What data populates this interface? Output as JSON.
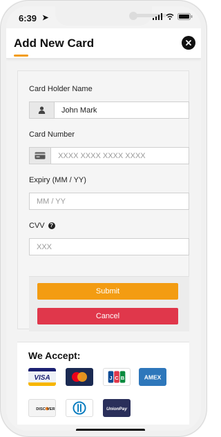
{
  "status_bar": {
    "time": "6:39",
    "icons": [
      "location-arrow-icon",
      "signal-icon",
      "wifi-icon",
      "battery-icon"
    ]
  },
  "header": {
    "title": "Add New Card",
    "accent_color": "#f39c12"
  },
  "form": {
    "holder_label": "Card Holder Name",
    "holder_value": "John Mark",
    "number_label": "Card Number",
    "number_placeholder": "XXXX XXXX XXXX XXXX",
    "expiry_label": "Expiry (MM / YY)",
    "expiry_placeholder": "MM / YY",
    "cvv_label": "CVV",
    "cvv_help": "?",
    "cvv_placeholder": "XXX",
    "submit_label": "Submit",
    "cancel_label": "Cancel",
    "submit_color": "#f39c12",
    "cancel_color": "#e0374b"
  },
  "accept": {
    "title": "We Accept:",
    "cards": [
      {
        "name": "VISA",
        "icon": "visa-logo"
      },
      {
        "name": "Mastercard",
        "icon": "mastercard-logo"
      },
      {
        "name": "JCB",
        "icon": "jcb-logo"
      },
      {
        "name": "AMEX",
        "icon": "amex-logo"
      },
      {
        "name": "DISCOVER",
        "icon": "discover-logo"
      },
      {
        "name": "Diners Club",
        "icon": "diners-club-logo"
      },
      {
        "name": "UnionPay",
        "icon": "unionpay-logo"
      }
    ]
  }
}
